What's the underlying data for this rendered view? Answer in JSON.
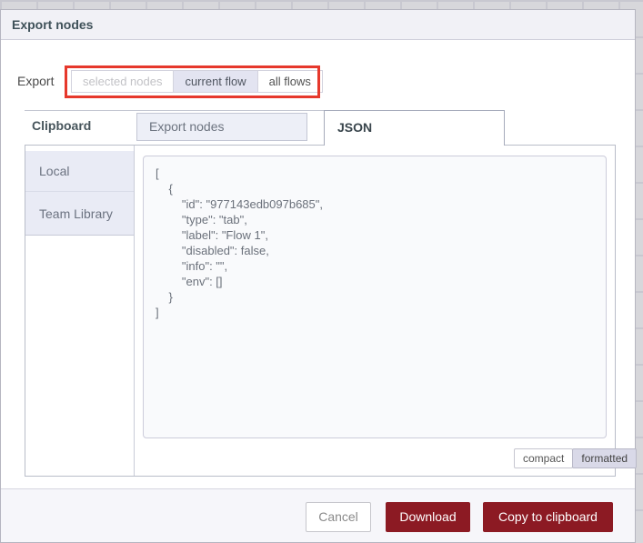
{
  "dialog": {
    "title": "Export nodes",
    "export_row": {
      "label": "Export",
      "options": [
        {
          "label": "selected nodes",
          "state": "disabled"
        },
        {
          "label": "current flow",
          "state": "selected"
        },
        {
          "label": "all flows",
          "state": "normal"
        }
      ]
    },
    "library_label": "Clipboard",
    "tabs": [
      {
        "label": "Export nodes",
        "active": false
      },
      {
        "label": "JSON",
        "active": true
      }
    ],
    "sidebar": {
      "items": [
        {
          "label": "Local"
        },
        {
          "label": "Team Library"
        }
      ]
    },
    "json_view": {
      "text": "[\n    {\n        \"id\": \"977143edb097b685\",\n        \"type\": \"tab\",\n        \"label\": \"Flow 1\",\n        \"disabled\": false,\n        \"info\": \"\",\n        \"env\": []\n    }\n]"
    },
    "format_toggle": [
      {
        "label": "compact",
        "selected": false
      },
      {
        "label": "formatted",
        "selected": true
      }
    ],
    "footer": {
      "buttons": [
        {
          "label": "Cancel",
          "style": "secondary"
        },
        {
          "label": "Download",
          "style": "primary"
        },
        {
          "label": "Copy to clipboard",
          "style": "primary"
        }
      ]
    }
  },
  "annotation": {
    "shape": "rectangle",
    "color": "#e6382c",
    "purpose": "highlights export scope options"
  },
  "colors": {
    "primary_button": "#8c1a23",
    "header_bg": "#f1f1f6",
    "tab_inactive_bg": "#edeff7",
    "sidebar_item_bg": "#e9ebf5",
    "selected_option_bg": "#e3e4f1",
    "annotation_red": "#e6382c"
  }
}
